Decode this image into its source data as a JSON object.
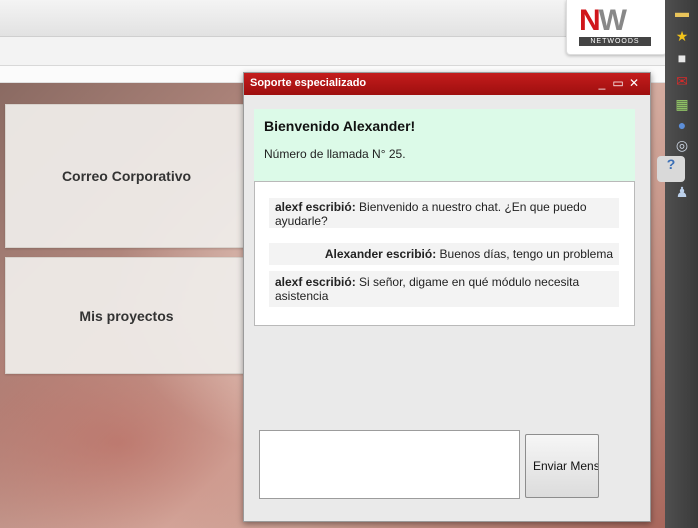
{
  "logo": {
    "letters_n": "N",
    "letters_w": "W",
    "subtitle": "NETWOODS"
  },
  "tiles": [
    {
      "label": "Correo Corporativo"
    },
    {
      "label": "Mis proyectos"
    }
  ],
  "chat": {
    "window_title": "Soporte especializado",
    "controls": {
      "minimize": "_",
      "maximize": "▭",
      "close": "✕"
    },
    "welcome_title": "Bienvenido Alexander!",
    "call_number": "Número de llamada N° 25.",
    "messages": [
      {
        "author": "alexf escribió:",
        "text": " Bienvenido a nuestro chat. ¿En que puedo ayudarle?"
      },
      {
        "author": "Alexander escribió:",
        "text": " Buenos días, tengo un problema"
      },
      {
        "author": "alexf escribió:",
        "text": " Si señor, digame en qué módulo necesita asistencia"
      }
    ],
    "input_value": "",
    "send_label": "Enviar Mensaje"
  },
  "dock": {
    "icons": [
      "folder-icon",
      "star-icon",
      "chat-icon",
      "mail-icon",
      "calculator-icon",
      "globe-icon",
      "search-icon",
      "help-icon",
      "user-icon"
    ]
  },
  "colors": {
    "titlebar": "#b01515",
    "welcome_bg": "#dcfae8",
    "dock_bg": "#444444",
    "brand_red": "#d0161b"
  }
}
